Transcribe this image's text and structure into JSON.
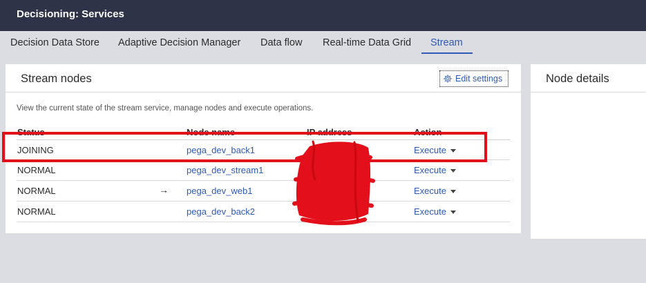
{
  "header": {
    "title": "Decisioning: Services"
  },
  "tabs": [
    {
      "label": "Decision Data Store"
    },
    {
      "label": "Adaptive Decision Manager"
    },
    {
      "label": "Data flow"
    },
    {
      "label": "Real-time Data Grid"
    },
    {
      "label": "Stream",
      "active": true
    }
  ],
  "stream_panel": {
    "title": "Stream nodes",
    "edit_settings_label": "Edit settings",
    "description": "View the current state of the stream service, manage nodes and execute operations.",
    "columns": [
      "Status",
      "Node name",
      "IP address",
      "Action"
    ],
    "rows": [
      {
        "status": "JOINING",
        "node_name": "pega_dev_back1",
        "current": false,
        "action": "Execute"
      },
      {
        "status": "NORMAL",
        "node_name": "pega_dev_stream1",
        "current": false,
        "action": "Execute"
      },
      {
        "status": "NORMAL",
        "node_name": "pega_dev_web1",
        "current": true,
        "current_marker": "→",
        "action": "Execute"
      },
      {
        "status": "NORMAL",
        "node_name": "pega_dev_back2",
        "current": false,
        "action": "Execute"
      }
    ]
  },
  "details_panel": {
    "title": "Node details"
  },
  "icons": {
    "gear": "gear-icon",
    "caret": "chevron-down-icon",
    "arrow": "arrow-right-icon"
  },
  "colors": {
    "titlebar": "#2e3347",
    "link": "#2f59b5",
    "annotation_red": "#e3101b",
    "background": "#dcdde2"
  }
}
